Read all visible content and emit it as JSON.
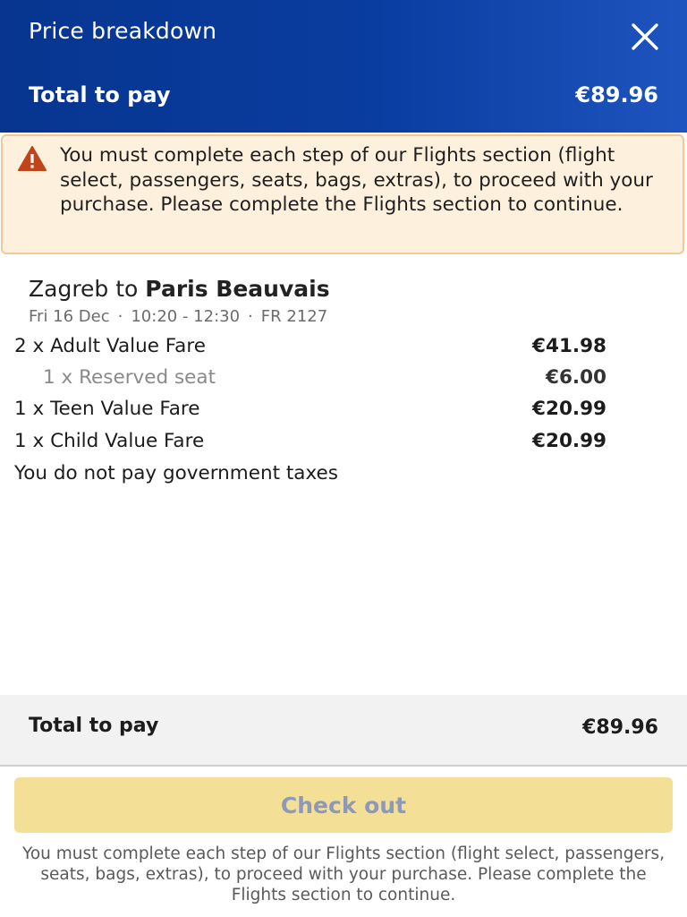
{
  "header": {
    "title": "Price breakdown",
    "total_label": "Total to pay",
    "total_value": "€89.96"
  },
  "warning": {
    "icon": "warning-triangle-icon",
    "text": "You must complete each step of our Flights section (flight select, passengers, seats, bags, extras), to proceed with your purchase. Please complete the Flights section to continue."
  },
  "flight": {
    "route_from": "Zagreb to ",
    "route_to": "Paris Beauvais",
    "date": "Fri 16 Dec",
    "time": "10:20 - 12:30",
    "flight_number": "FR 2127",
    "lines": [
      {
        "label": "2 x Adult Value Fare",
        "amount": "€41.98",
        "sub": false
      },
      {
        "label": "1 x Reserved seat",
        "amount": "€6.00",
        "sub": true
      },
      {
        "label": "1 x Teen Value Fare",
        "amount": "€20.99",
        "sub": false
      },
      {
        "label": "1 x Child Value Fare",
        "amount": "€20.99",
        "sub": false
      }
    ],
    "tax_note": "You do not pay government taxes"
  },
  "footer": {
    "total_label": "Total to pay",
    "total_value": "€89.96",
    "checkout_label": "Check out",
    "note": "You must complete each step of our Flights section (flight select, passengers, seats, bags, extras), to proceed with your purchase. Please complete the Flights section to continue."
  },
  "colors": {
    "header_blue": "#073590",
    "checkout_yellow": "#f3df96",
    "warning_bg": "#fdf1dd",
    "warning_icon": "#c0441a"
  }
}
